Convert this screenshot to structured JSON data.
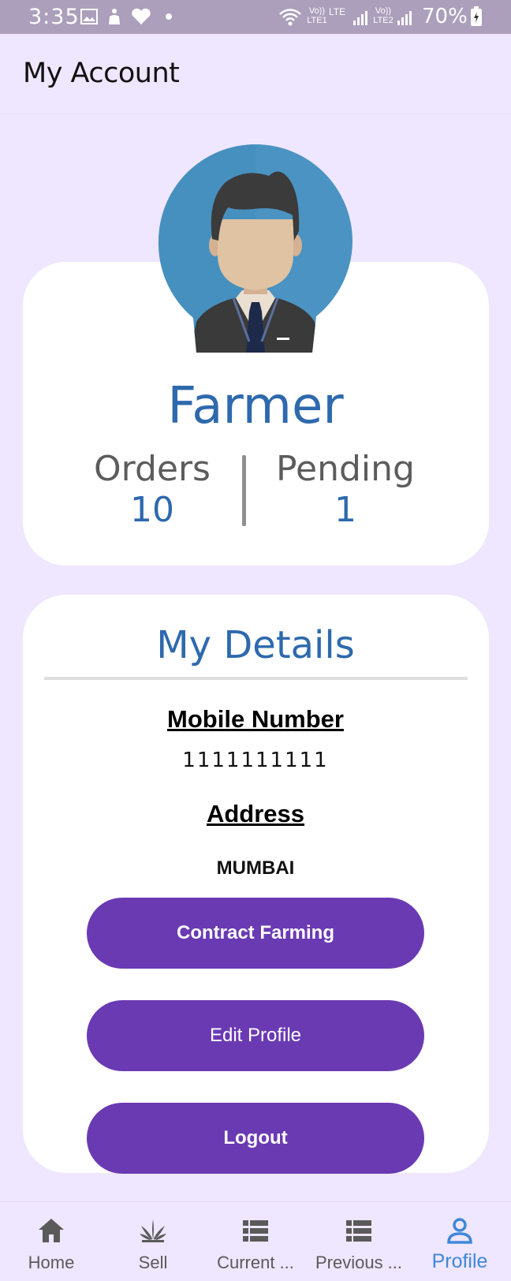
{
  "status_bar": {
    "time": "3:35",
    "battery": "70%",
    "icons": [
      "gallery-icon",
      "hand-icon",
      "heart-icon",
      "dot-icon",
      "wifi-icon",
      "volte-lte1-icon",
      "signal-icon",
      "volte-lte2-icon",
      "signal-icon",
      "battery-charging-icon"
    ],
    "sim1_label_top": "Vo))",
    "sim1_label_bottom": "LTE1",
    "sim1_net": "LTE",
    "sim2_label_top": "Vo))",
    "sim2_label_bottom": "LTE2"
  },
  "app_bar": {
    "title": "My Account"
  },
  "profile": {
    "name": "Farmer",
    "avatar_icon": "farmer-avatar-icon",
    "stats": [
      {
        "label": "Orders",
        "value": "10"
      },
      {
        "label": "Pending",
        "value": "1"
      }
    ]
  },
  "details": {
    "title": "My Details",
    "mobile_label": "Mobile Number",
    "mobile_value": "1111111111",
    "address_label": "Address",
    "address_value": "MUMBAI"
  },
  "buttons": {
    "contract_farming": "Contract Farming",
    "edit_profile": "Edit Profile",
    "logout": "Logout"
  },
  "bottom_nav": {
    "items": [
      {
        "label": "Home",
        "icon": "home-icon"
      },
      {
        "label": "Sell",
        "icon": "sprout-icon"
      },
      {
        "label": "Current ...",
        "icon": "list-icon"
      },
      {
        "label": "Previous ...",
        "icon": "list-icon"
      },
      {
        "label": "Profile",
        "icon": "person-icon"
      }
    ],
    "active": "Profile"
  },
  "colors": {
    "background": "#efe6ff",
    "accent_blue": "#2e69ad",
    "button_purple": "#6a3ab3",
    "nav_active": "#3f88d9",
    "status_bar": "#ab9fbb"
  }
}
